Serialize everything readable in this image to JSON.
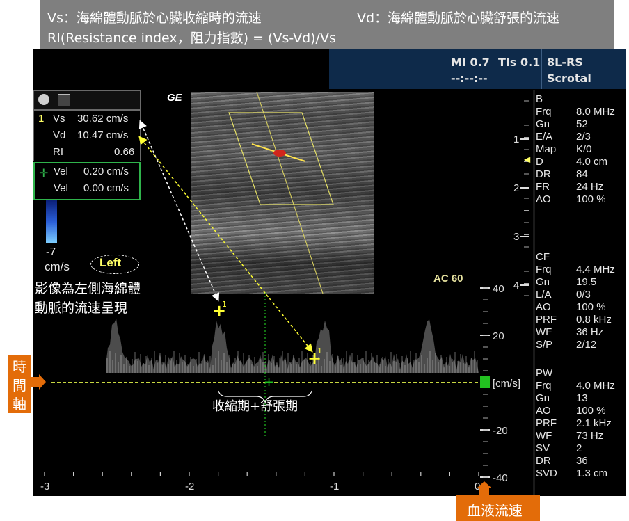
{
  "caption": {
    "vs_def": "Vs：海綿體動脈於心臟收縮時的流速",
    "vd_def": "Vd：海綿體動脈於心臟舒張的流速",
    "ri_def": "RI(Resistance index，阻力指數) = (Vs-Vd)/Vs"
  },
  "header": {
    "mi": "MI 0.7",
    "tis": "TIs 0.1",
    "probe": "8L-RS",
    "time": "--:--:--",
    "preset": "Scrotal"
  },
  "logo": "GE",
  "measurements": {
    "index": "1",
    "vs_label": "Vs",
    "vs_value": "30.62 cm/s",
    "vd_label": "Vd",
    "vd_value": "10.47 cm/s",
    "ri_label": "RI",
    "ri_value": "0.66",
    "vel1_label": "Vel",
    "vel1_value": "0.20 cm/s",
    "vel2_label": "Vel",
    "vel2_value": "0.00 cm/s"
  },
  "colorbar": {
    "min_label": "-7",
    "unit": "cm/s"
  },
  "annotations": {
    "left_tag": "Left",
    "left_note_line1": "影像為左側海綿體",
    "left_note_line2": "動脈的流速呈現",
    "cycle_label": "收縮期+舒張期",
    "time_axis": [
      "時",
      "間",
      "軸"
    ],
    "velocity_label": "血液流速",
    "ac": "AC 60",
    "cursor_marker": "1"
  },
  "depth_scale": [
    "1",
    "2",
    "3",
    "4"
  ],
  "velocity_scale": {
    "ticks": [
      "40",
      "20",
      "[cm/s]",
      "-20",
      "-40"
    ],
    "values": [
      40,
      20,
      0,
      -20,
      -40
    ]
  },
  "time_scale": {
    "ticks": [
      "-3",
      "-2",
      "-1",
      "0"
    ],
    "values": [
      -3,
      -2,
      -1,
      0
    ]
  },
  "params": {
    "b": {
      "title": "B",
      "rows": [
        [
          "Frq",
          "8.0 MHz"
        ],
        [
          "Gn",
          "52"
        ],
        [
          "E/A",
          "2/3"
        ],
        [
          "Map",
          "K/0"
        ],
        [
          "D",
          "4.0 cm"
        ],
        [
          "DR",
          "84"
        ],
        [
          "FR",
          "24 Hz"
        ],
        [
          "AO",
          "100 %"
        ]
      ]
    },
    "cf": {
      "title": "CF",
      "rows": [
        [
          "Frq",
          "4.4 MHz"
        ],
        [
          "Gn",
          "19.5"
        ],
        [
          "L/A",
          "0/3"
        ],
        [
          "AO",
          "100 %"
        ],
        [
          "PRF",
          "0.8 kHz"
        ],
        [
          "WF",
          "36 Hz"
        ],
        [
          "S/P",
          "2/12"
        ]
      ]
    },
    "pw": {
      "title": "PW",
      "rows": [
        [
          "Frq",
          "4.0 MHz"
        ],
        [
          "Gn",
          "13"
        ],
        [
          "AO",
          "100 %"
        ],
        [
          "PRF",
          "2.1 kHz"
        ],
        [
          "WF",
          "73 Hz"
        ],
        [
          "SV",
          "2"
        ],
        [
          "DR",
          "36"
        ],
        [
          "SVD",
          "1.3 cm"
        ]
      ]
    }
  },
  "colors": {
    "accent_yellow": "#ffff66",
    "accent_green": "#2fb34b",
    "annotation_orange": "#e36c09",
    "screen_bg": "#000000"
  }
}
